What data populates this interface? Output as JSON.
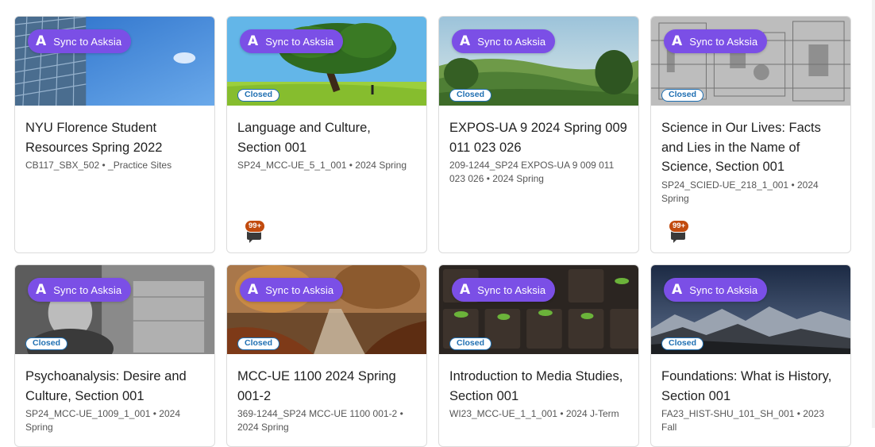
{
  "sync_label": "Sync to Asksia",
  "sync_icon": "A",
  "closed_label": "Closed",
  "accent_color": "#7b4fe6",
  "closed_color": "#1f6fb2",
  "courses": [
    {
      "title": "NYU Florence Student Resources Spring 2022",
      "meta": "CB117_SBX_502  •  _Practice Sites",
      "closed": false,
      "notifications": null,
      "banner": "skyscraper"
    },
    {
      "title": "Language and Culture, Section 001",
      "meta": "SP24_MCC-UE_5_1_001  •  2024 Spring",
      "closed": true,
      "notifications": "99+",
      "banner": "tree"
    },
    {
      "title": "EXPOS-UA 9 2024 Spring 009 011 023 026",
      "meta": "209-1244_SP24 EXPOS-UA 9 009 011 023 026  •  2024 Spring",
      "closed": true,
      "notifications": null,
      "banner": "hills"
    },
    {
      "title": "Science in Our Lives: Facts and Lies in the Name of Science, Section 001",
      "meta": "SP24_SCIED-UE_218_1_001  •  2024 Spring",
      "closed": true,
      "notifications": "99+",
      "banner": "engraving"
    },
    {
      "title": "Psychoanalysis: Desire and Culture, Section 001",
      "meta": "SP24_MCC-UE_1009_1_001  •  2024 Spring",
      "closed": true,
      "notifications": null,
      "banner": "portrait"
    },
    {
      "title": "MCC-UE 1100 2024 Spring 001-2",
      "meta": "369-1244_SP24 MCC-UE 1100 001-2  •  2024 Spring",
      "closed": true,
      "notifications": null,
      "banner": "autumn"
    },
    {
      "title": "Introduction to Media Studies, Section 001",
      "meta": "WI23_MCC-UE_1_1_001  •  2024 J-Term",
      "closed": true,
      "notifications": null,
      "banner": "seedlings"
    },
    {
      "title": "Foundations: What is History, Section 001",
      "meta": "FA23_HIST-SHU_101_SH_001  •  2023 Fall",
      "closed": true,
      "notifications": null,
      "banner": "mountains"
    }
  ]
}
